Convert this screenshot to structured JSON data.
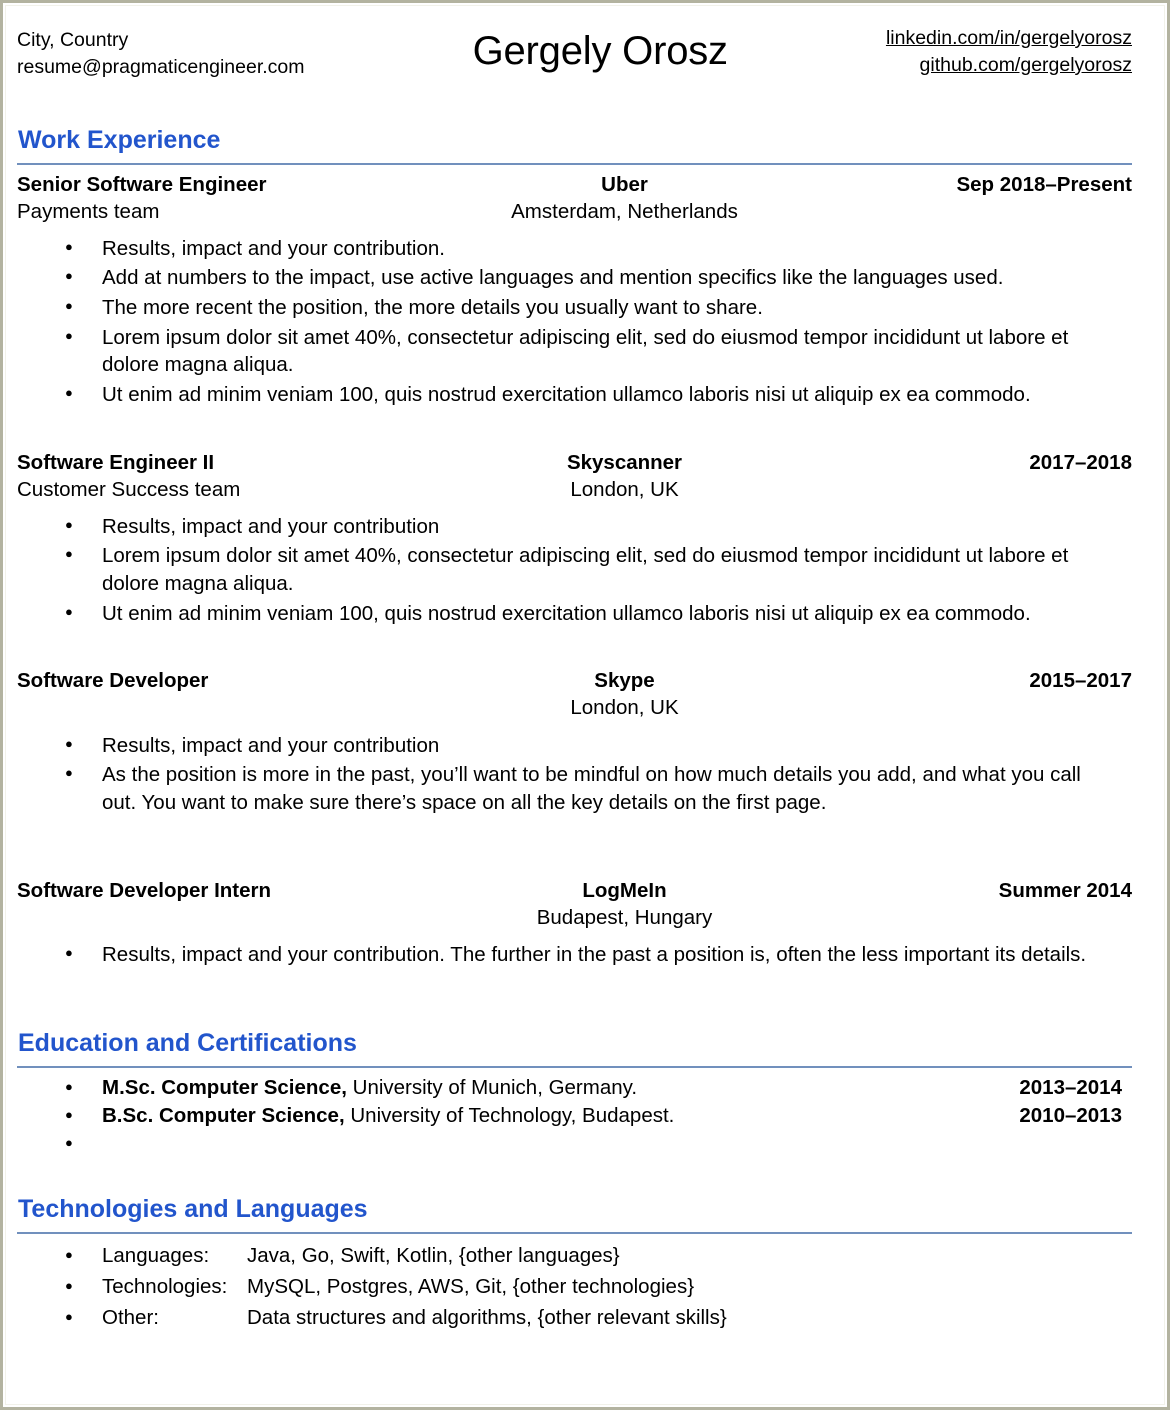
{
  "document": {
    "type": "resume",
    "accent_color": "#2255cc",
    "rule_color": "#7190bd",
    "page_border_color": "#b3b3a0"
  },
  "header": {
    "location": "City, Country",
    "email": "resume@pragmaticengineer.com",
    "name": "Gergely Orosz",
    "linkedin": "linkedin.com/in/gergelyorosz",
    "github": "github.com/gergelyorosz"
  },
  "sections": {
    "work": {
      "title": "Work Experience",
      "jobs": [
        {
          "title": "Senior Software Engineer",
          "company": "Uber",
          "dates": "Sep 2018–Present",
          "team": "Payments team",
          "location": "Amsterdam, Netherlands",
          "bullets": [
            "Results, impact and your contribution.",
            "Add at numbers to the impact, use active languages and mention specifics like the languages used.",
            "The more recent the position, the more details you usually want to share.",
            "Lorem ipsum dolor sit amet 40%, consectetur adipiscing elit, sed do eiusmod tempor incididunt ut labore et dolore magna aliqua.",
            "Ut enim ad minim veniam 100, quis nostrud exercitation ullamco laboris nisi ut aliquip ex ea commodo."
          ]
        },
        {
          "title": "Software Engineer II",
          "company": "Skyscanner",
          "dates": "2017–2018",
          "team": "Customer Success team",
          "location": "London, UK",
          "bullets": [
            "Results, impact and your contribution",
            "Lorem ipsum dolor sit amet 40%, consectetur adipiscing elit, sed do eiusmod tempor incididunt ut labore et dolore magna aliqua.",
            "Ut enim ad minim veniam 100, quis nostrud exercitation ullamco laboris nisi ut aliquip ex ea commodo."
          ]
        },
        {
          "title": "Software Developer",
          "company": "Skype",
          "dates": "2015–2017",
          "team": "",
          "location": "London, UK",
          "bullets": [
            "Results, impact and your contribution",
            "As the position is more in the past, you’ll want to be mindful on how much details you add, and what you call out. You want to make sure there’s space on all the key details on the first page."
          ]
        },
        {
          "title": "Software Developer Intern",
          "company": "LogMeIn",
          "dates": "Summer 2014",
          "team": "",
          "location": "Budapest, Hungary",
          "bullets": [
            "Results, impact and your contribution. The further in the past a position is, often the less important its details."
          ]
        }
      ]
    },
    "education": {
      "title": "Education and Certifications",
      "entries": [
        {
          "degree": "M.Sc. Computer Science,",
          "institution": " University of Munich, Germany.",
          "years": "2013–2014"
        },
        {
          "degree": "B.Sc. Computer Science,",
          "institution": " University of Technology, Budapest.",
          "years": "2010–2013"
        },
        {
          "degree": "",
          "institution": "",
          "years": ""
        }
      ]
    },
    "skills": {
      "title": "Technologies and Languages",
      "rows": [
        {
          "label": "Languages:",
          "value": "Java, Go, Swift, Kotlin, {other languages}"
        },
        {
          "label": "Technologies:",
          "value": "MySQL, Postgres, AWS, Git, {other technologies}"
        },
        {
          "label": "Other:",
          "value": "Data structures and algorithms, {other relevant skills}"
        }
      ]
    }
  }
}
